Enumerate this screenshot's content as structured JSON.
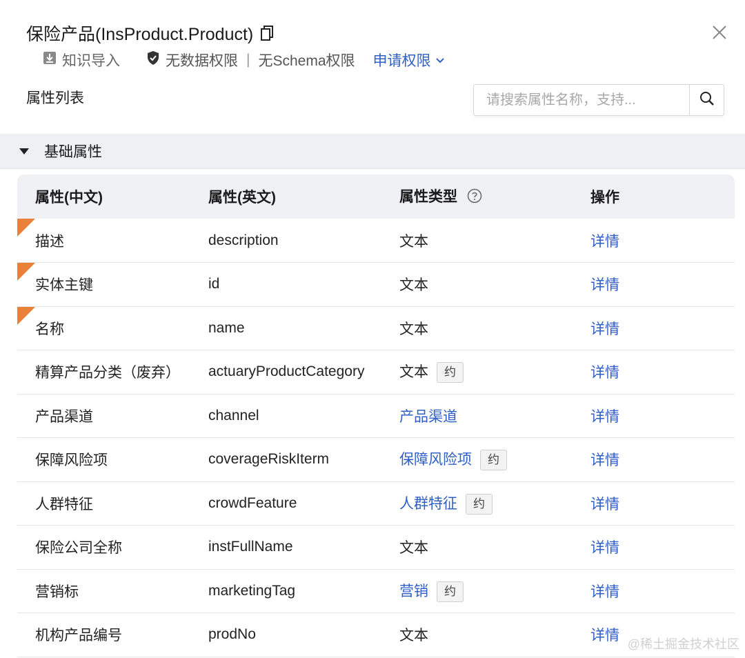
{
  "header": {
    "title": "保险产品(InsProduct.Product)",
    "import_label": "知识导入",
    "data_permission": "无数据权限",
    "separator": "|",
    "schema_permission": "无Schema权限",
    "request_permission": "申请权限"
  },
  "section": {
    "title": "属性列表"
  },
  "search": {
    "placeholder": "请搜索属性名称，支持..."
  },
  "group": {
    "label": "基础属性"
  },
  "table": {
    "columns": [
      "属性(中文)",
      "属性(英文)",
      "属性类型",
      "操作"
    ],
    "rows": [
      {
        "cn": "描述",
        "en": "description",
        "type": "文本",
        "type_link": false,
        "badge": "",
        "flag": true,
        "action": "详情"
      },
      {
        "cn": "实体主键",
        "en": "id",
        "type": "文本",
        "type_link": false,
        "badge": "",
        "flag": true,
        "action": "详情"
      },
      {
        "cn": "名称",
        "en": "name",
        "type": "文本",
        "type_link": false,
        "badge": "",
        "flag": true,
        "action": "详情"
      },
      {
        "cn": "精算产品分类（废弃）",
        "en": "actuaryProductCategory",
        "type": "文本",
        "type_link": false,
        "badge": "约",
        "flag": false,
        "action": "详情"
      },
      {
        "cn": "产品渠道",
        "en": "channel",
        "type": "产品渠道",
        "type_link": true,
        "badge": "",
        "flag": false,
        "action": "详情"
      },
      {
        "cn": "保障风险项",
        "en": "coverageRiskIterm",
        "type": "保障风险项",
        "type_link": true,
        "badge": "约",
        "flag": false,
        "action": "详情"
      },
      {
        "cn": "人群特征",
        "en": "crowdFeature",
        "type": "人群特征",
        "type_link": true,
        "badge": "约",
        "flag": false,
        "action": "详情"
      },
      {
        "cn": "保险公司全称",
        "en": "instFullName",
        "type": "文本",
        "type_link": false,
        "badge": "",
        "flag": false,
        "action": "详情"
      },
      {
        "cn": "营销标",
        "en": "marketingTag",
        "type": "营销",
        "type_link": true,
        "badge": "约",
        "flag": false,
        "action": "详情"
      },
      {
        "cn": "机构产品编号",
        "en": "prodNo",
        "type": "文本",
        "type_link": false,
        "badge": "",
        "flag": false,
        "action": "详情"
      }
    ]
  },
  "watermark": "@稀土掘金技术社区",
  "colors": {
    "link": "#2f5fc4",
    "flag": "#e8813a",
    "header_bg": "#f0f1f4",
    "group_bg": "#eef0f3"
  }
}
